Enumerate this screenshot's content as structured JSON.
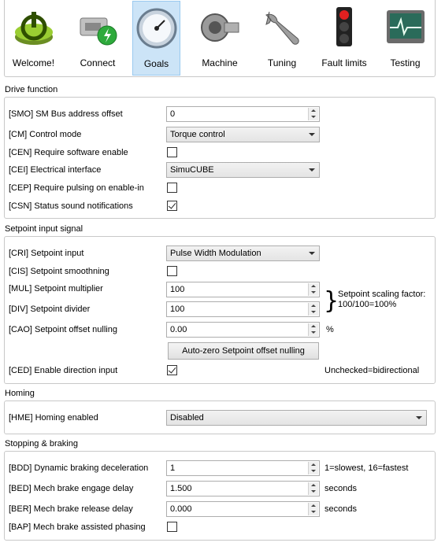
{
  "toolbar": {
    "tabs": [
      {
        "label": "Welcome!",
        "icon": "power-icon"
      },
      {
        "label": "Connect",
        "icon": "network-connector-icon"
      },
      {
        "label": "Goals",
        "icon": "pressure-gauge-icon",
        "active": true
      },
      {
        "label": "Machine",
        "icon": "motor-icon"
      },
      {
        "label": "Tuning",
        "icon": "wrench-icon"
      },
      {
        "label": "Fault limits",
        "icon": "traffic-light-icon"
      },
      {
        "label": "Testing",
        "icon": "oscilloscope-icon"
      }
    ]
  },
  "drive_function": {
    "title": "Drive function",
    "smo_label": "[SMO] SM Bus address offset",
    "smo_value": "0",
    "cm_label": "[CM] Control mode",
    "cm_value": "Torque control",
    "cen_label": "[CEN] Require software enable",
    "cen_checked": false,
    "cei_label": "[CEI] Electrical interface",
    "cei_value": "SimuCUBE",
    "cep_label": "[CEP] Require pulsing on enable-in",
    "cep_checked": false,
    "csn_label": "[CSN] Status sound notifications",
    "csn_checked": true
  },
  "setpoint": {
    "title": "Setpoint input signal",
    "cri_label": "[CRI] Setpoint input",
    "cri_value": "Pulse Width Modulation",
    "cis_label": "[CIS] Setpoint smoothning",
    "cis_checked": false,
    "mul_label": "[MUL] Setpoint multiplier",
    "mul_value": "100",
    "div_label": "[DIV] Setpoint divider",
    "div_value": "100",
    "scaling_note_1": "Setpoint scaling factor:",
    "scaling_note_2": "100/100=100%",
    "cao_label": "[CAO] Setpoint offset nulling",
    "cao_value": "0.00",
    "cao_unit": "%",
    "autozero_label": "Auto-zero Setpoint offset nulling",
    "ced_label": "[CED] Enable direction input",
    "ced_checked": true,
    "ced_note": "Unchecked=bidirectional"
  },
  "homing": {
    "title": "Homing",
    "hme_label": "[HME] Homing enabled",
    "hme_value": "Disabled"
  },
  "braking": {
    "title": "Stopping & braking",
    "bdd_label": "[BDD] Dynamic braking deceleration",
    "bdd_value": "1",
    "bdd_note": "1=slowest, 16=fastest",
    "bed_label": "[BED] Mech brake engage delay",
    "bed_value": "1.500",
    "bed_unit": "seconds",
    "ber_label": "[BER] Mech brake release delay",
    "ber_value": "0.000",
    "ber_unit": "seconds",
    "bap_label": "[BAP] Mech brake assisted phasing",
    "bap_checked": false
  }
}
